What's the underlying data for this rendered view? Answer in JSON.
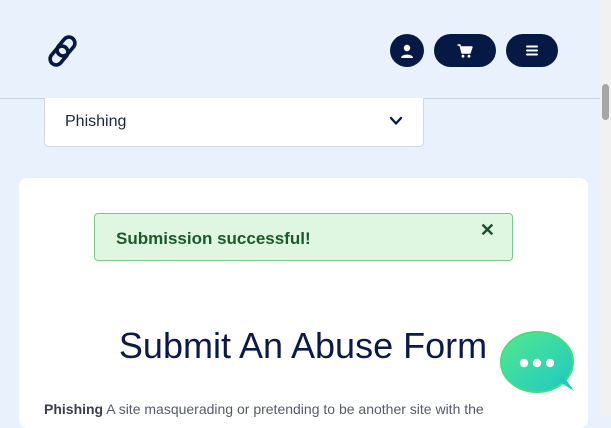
{
  "header": {
    "logo_icon": "chain-link-logo",
    "buttons": [
      {
        "icon": "user-icon"
      },
      {
        "icon": "cart-icon"
      },
      {
        "icon": "menu-icon"
      }
    ]
  },
  "form": {
    "abuse_type_select": {
      "selected": "Phishing"
    }
  },
  "alert": {
    "message": "Submission successful!",
    "close_label": "✕"
  },
  "main": {
    "title": "Submit An Abuse Form",
    "description_term": "Phishing",
    "description_text": " A site masquerading or pretending to be another site with the"
  },
  "chat_widget": {
    "icon": "chat-bubble-icon"
  },
  "colors": {
    "navy": "#061945",
    "page_bg": "#e9f1fc",
    "alert_bg": "#dff6e1",
    "alert_text": "#1a5a2b",
    "chat_teal": "#2fd6b0"
  }
}
